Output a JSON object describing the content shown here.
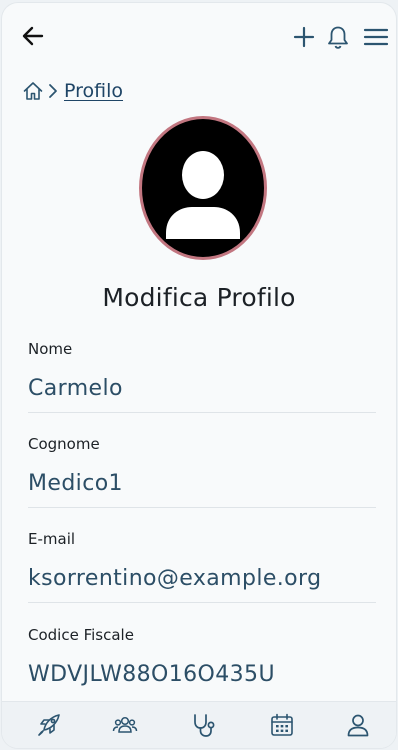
{
  "breadcrumb": {
    "current": "Profilo"
  },
  "page": {
    "title": "Modifica Profilo"
  },
  "fields": [
    {
      "label": "Nome",
      "value": "Carmelo"
    },
    {
      "label": "Cognome",
      "value": "Medico1"
    },
    {
      "label": "E-mail",
      "value": "ksorrentino@example.org"
    },
    {
      "label": "Codice Fiscale",
      "value": "WDVJLW88O16O435U"
    }
  ],
  "colors": {
    "accent": "#2c4e66",
    "avatar_ring": "#c27680",
    "icon": "#2c5570",
    "background": "#f8fafb"
  },
  "icons": {
    "topbar": [
      "arrow-left-icon",
      "plus-icon",
      "bell-icon",
      "menu-icon"
    ],
    "bottombar": [
      "rocket-icon",
      "users-icon",
      "stethoscope-icon",
      "calendar-icon",
      "user-icon"
    ]
  }
}
